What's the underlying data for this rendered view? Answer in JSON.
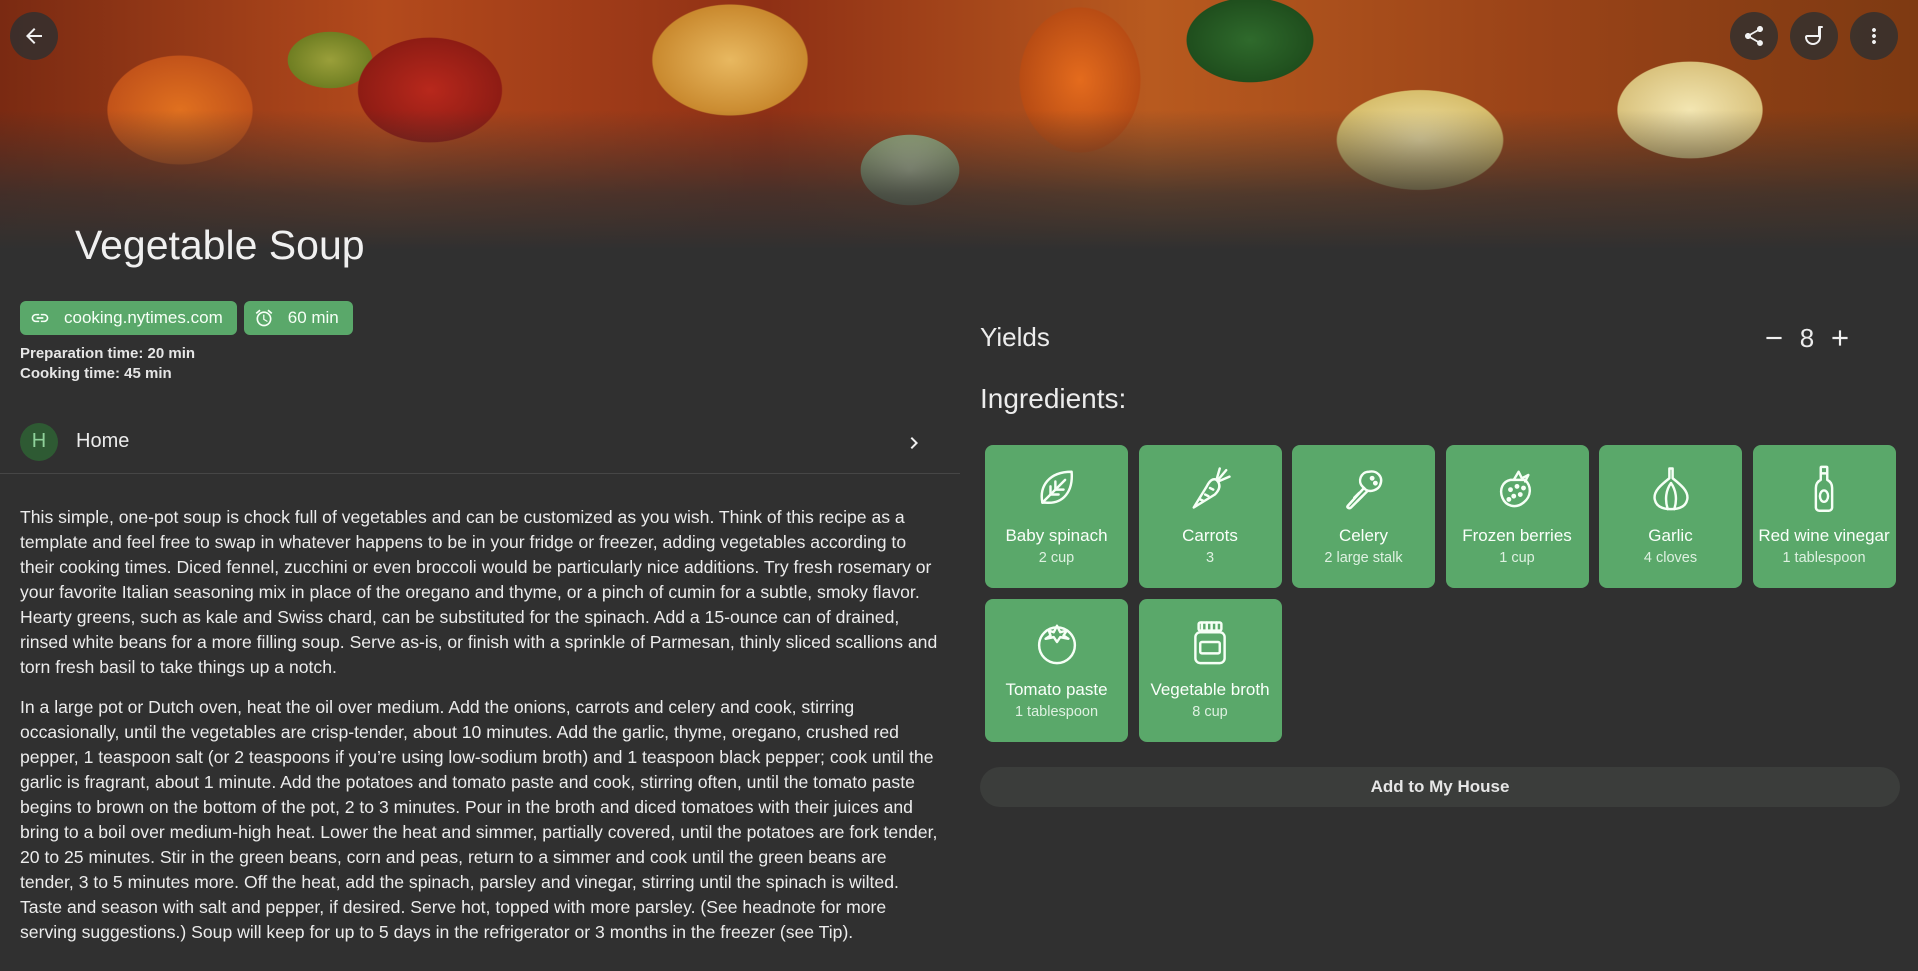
{
  "recipe": {
    "title": "Vegetable Soup",
    "source": "cooking.nytimes.com",
    "total_time": "60 min",
    "prep_time": "Preparation time: 20 min",
    "cook_time": "Cooking time: 45 min"
  },
  "household": {
    "avatar_letter": "H",
    "name": "Home"
  },
  "description": [
    "This simple, one-pot soup is chock full of vegetables and can be customized as you wish. Think of this recipe as a template and feel free to swap in whatever happens to be in your fridge or freezer, adding vegetables according to their cooking times. Diced fennel, zucchini or even broccoli would be particularly nice additions. Try fresh rosemary or your favorite Italian seasoning mix in place of the oregano and thyme, or a pinch of cumin for a subtle, smoky flavor. Hearty greens, such as kale and Swiss chard, can be substituted for the spinach. Add a 15-ounce can of drained, rinsed white beans for a more filling soup. Serve as-is, or finish with a sprinkle of Parmesan, thinly sliced scallions and torn fresh basil to take things up a notch.",
    "In a large pot or Dutch oven, heat the oil over medium. Add the onions, carrots and celery and cook, stirring occasionally, until the vegetables are crisp-tender, about 10 minutes. Add the garlic, thyme, oregano, crushed red pepper, 1 teaspoon salt (or 2 teaspoons if you’re using low-sodium broth) and 1 teaspoon black pepper; cook until the garlic is fragrant, about 1 minute. Add the potatoes and tomato paste and cook, stirring often, until the tomato paste begins to brown on the bottom of the pot, 2 to 3 minutes. Pour in the broth and diced tomatoes with their juices and bring to a boil over medium-high heat. Lower the heat and simmer, partially covered, until the potatoes are fork tender, 20 to 25 minutes. Stir in the green beans, corn and peas, return to a simmer and cook until the green beans are tender, 3 to 5 minutes more. Off the heat, add the spinach, parsley and vinegar, stirring until the spinach is wilted. Taste and season with salt and pepper, if desired. Serve hot, topped with more parsley. (See headnote for more serving suggestions.) Soup will keep for up to 5 days in the refrigerator or 3 months in the freezer (see Tip)."
  ],
  "yields": {
    "label": "Yields",
    "value": "8"
  },
  "ingredients": {
    "label": "Ingredients:",
    "items": [
      {
        "name": "Baby spinach",
        "amount": "2 cup",
        "icon": "leaf-icon"
      },
      {
        "name": "Carrots",
        "amount": "3",
        "icon": "carrot-icon"
      },
      {
        "name": "Celery",
        "amount": "2 large stalk",
        "icon": "celery-icon"
      },
      {
        "name": "Frozen berries",
        "amount": "1 cup",
        "icon": "strawberry-icon"
      },
      {
        "name": "Garlic",
        "amount": "4 cloves",
        "icon": "garlic-icon"
      },
      {
        "name": "Red wine vinegar",
        "amount": "1 tablespoon",
        "icon": "bottle-icon"
      },
      {
        "name": "Tomato paste",
        "amount": "1 tablespoon",
        "icon": "tomato-icon"
      },
      {
        "name": "Vegetable broth",
        "amount": "8 cup",
        "icon": "jar-icon"
      }
    ],
    "add_button": "Add to My House"
  },
  "colors": {
    "accent": "#5aa86a",
    "background": "#303030"
  }
}
